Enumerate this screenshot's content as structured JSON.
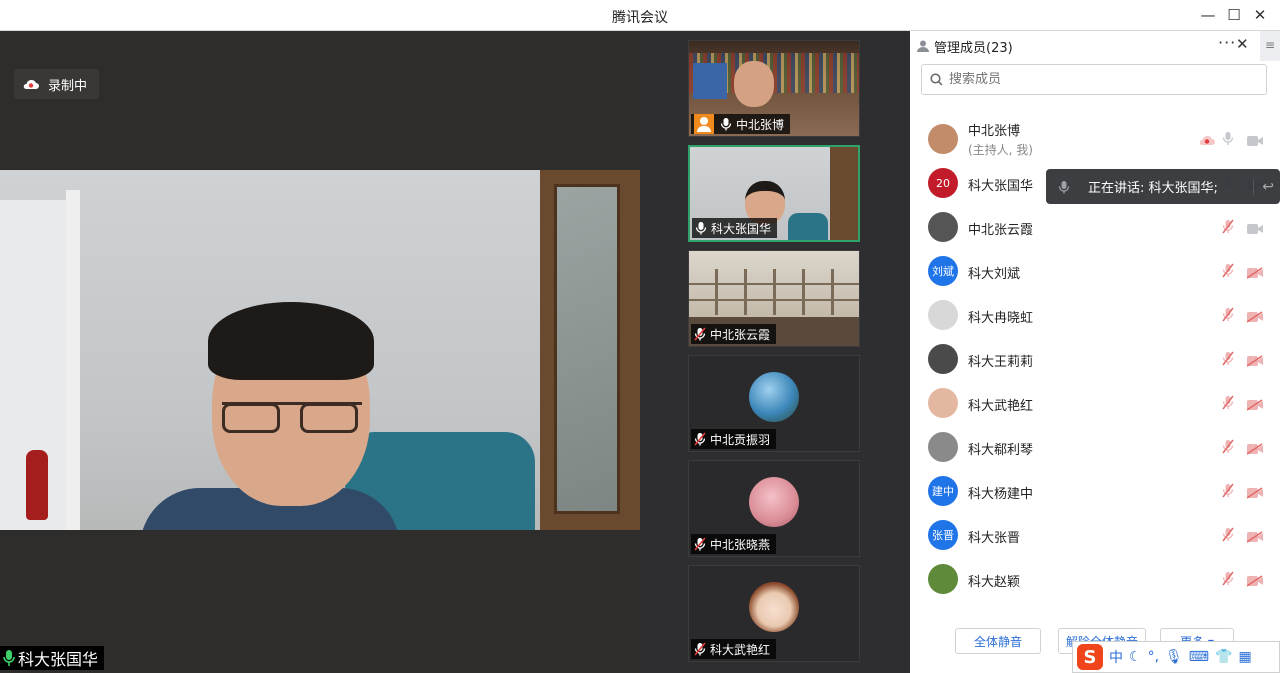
{
  "window": {
    "title": "腾讯会议"
  },
  "recording": {
    "label": "录制中"
  },
  "main_video": {
    "speaker_name": "科大张国华"
  },
  "gallery": [
    {
      "name": "中北张博",
      "mic": "on",
      "host": true,
      "type": "video",
      "bg": "#6b4f3a"
    },
    {
      "name": "科大张国华",
      "mic": "on",
      "host": false,
      "type": "video",
      "active": true,
      "bg": "#c8ccce"
    },
    {
      "name": "中北张云霞",
      "mic": "muted",
      "host": false,
      "type": "video",
      "bg": "#c9bfb0"
    },
    {
      "name": "中北贡振羽",
      "mic": "muted",
      "host": false,
      "type": "avatar",
      "avatar_color": "#3b86b8"
    },
    {
      "name": "中北张晓燕",
      "mic": "muted",
      "host": false,
      "type": "avatar",
      "avatar_color": "#d98c95"
    },
    {
      "name": "科大武艳红",
      "mic": "muted",
      "host": false,
      "type": "avatar",
      "avatar_color": "#e9c9b0"
    }
  ],
  "panel": {
    "title": "管理成员(23)",
    "search_placeholder": "搜索成员",
    "members": [
      {
        "name": "中北张博",
        "sub": "(主持人, 我)",
        "avatar_color": "#c28c6a",
        "avatar_text": "",
        "mic": "on",
        "cam": "on",
        "recording": true
      },
      {
        "name": "科大张国华",
        "avatar_color": "#c21b2a",
        "avatar_text": "20",
        "mic": "on",
        "cam": "on"
      },
      {
        "name": "中北张云霞",
        "avatar_color": "#555555",
        "avatar_text": "",
        "mic": "muted",
        "cam": "on"
      },
      {
        "name": "科大刘斌",
        "avatar_color": "#1f74e8",
        "avatar_text": "刘斌",
        "mic": "muted",
        "cam": "off"
      },
      {
        "name": "科大冉晓虹",
        "avatar_color": "#d8d8d8",
        "avatar_text": "",
        "mic": "muted",
        "cam": "off"
      },
      {
        "name": "科大王莉莉",
        "avatar_color": "#4a4a4a",
        "avatar_text": "",
        "mic": "muted",
        "cam": "off"
      },
      {
        "name": "科大武艳红",
        "avatar_color": "#e4b8a0",
        "avatar_text": "",
        "mic": "muted",
        "cam": "off"
      },
      {
        "name": "科大郗利琴",
        "avatar_color": "#8a8a8a",
        "avatar_text": "",
        "mic": "muted",
        "cam": "off"
      },
      {
        "name": "科大杨建中",
        "avatar_color": "#1f74e8",
        "avatar_text": "建中",
        "mic": "muted",
        "cam": "off"
      },
      {
        "name": "科大张晋",
        "avatar_color": "#1f74e8",
        "avatar_text": "张晋",
        "mic": "muted",
        "cam": "off"
      },
      {
        "name": "科大赵颖",
        "avatar_color": "#5f8a3a",
        "avatar_text": "",
        "mic": "muted",
        "cam": "off"
      }
    ],
    "speaking_text": "正在讲话: 科大张国华;",
    "footer": {
      "mute_all": "全体静音",
      "unmute_all": "解除全体静音",
      "more": "更多 ▾"
    }
  },
  "ime": {
    "logo": "S",
    "mode": "中"
  },
  "colors": {
    "accent": "#2c6fd6",
    "active_border": "#2fa36a",
    "muted": "#e06a6a",
    "host": "#f08a1c"
  }
}
